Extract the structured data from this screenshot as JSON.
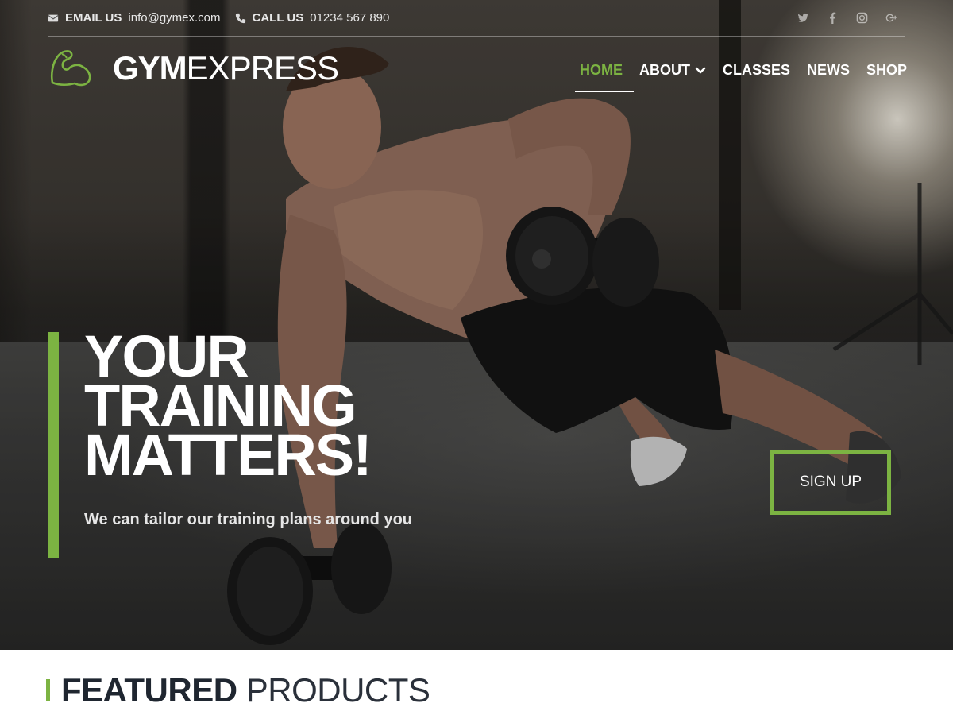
{
  "topbar": {
    "email_label": "EMAIL US",
    "email_value": "info@gymex.com",
    "phone_label": "CALL US",
    "phone_value": "01234 567 890",
    "social_icons": [
      "twitter-icon",
      "facebook-icon",
      "instagram-icon",
      "google-plus-icon"
    ]
  },
  "brand": {
    "name_bold": "GYM",
    "name_light": "EXPRESS",
    "logo_icon": "flexed-arm-icon"
  },
  "nav": {
    "items": [
      {
        "label": "HOME",
        "active": true
      },
      {
        "label": "ABOUT",
        "has_dropdown": true
      },
      {
        "label": "CLASSES"
      },
      {
        "label": "NEWS"
      },
      {
        "label": "SHOP"
      }
    ]
  },
  "hero": {
    "headline_lines": [
      "YOUR",
      "TRAINING",
      "MATTERS!"
    ],
    "subheadline": "We can tailor our training plans around you",
    "cta_label": "SIGN UP"
  },
  "featured": {
    "title_bold": "FEATURED",
    "title_light": "PRODUCTS"
  },
  "colors": {
    "accent": "#7cb342",
    "heading": "#1f2630",
    "text_light": "#ffffff"
  }
}
